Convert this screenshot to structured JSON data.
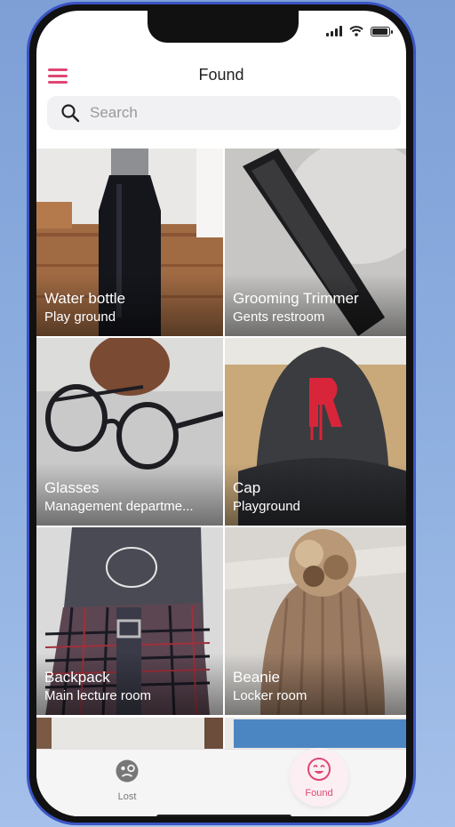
{
  "header": {
    "title": "Found"
  },
  "search": {
    "placeholder": "Search"
  },
  "items": [
    {
      "name": "Water bottle",
      "location": "Play ground"
    },
    {
      "name": "Grooming Trimmer",
      "location": "Gents restroom"
    },
    {
      "name": "Glasses",
      "location": "Management departme..."
    },
    {
      "name": "Cap",
      "location": "Playground"
    },
    {
      "name": "Backpack",
      "location": "Main lecture room"
    },
    {
      "name": "Beanie",
      "location": "Locker room"
    }
  ],
  "tabs": {
    "lost": "Lost",
    "found": "Found"
  },
  "colors": {
    "accent": "#e04672",
    "inactive": "#777777"
  },
  "icons": {
    "menu": "hamburger-menu-icon",
    "search": "search-icon",
    "lost": "sad-face-icon",
    "found": "happy-face-icon"
  }
}
